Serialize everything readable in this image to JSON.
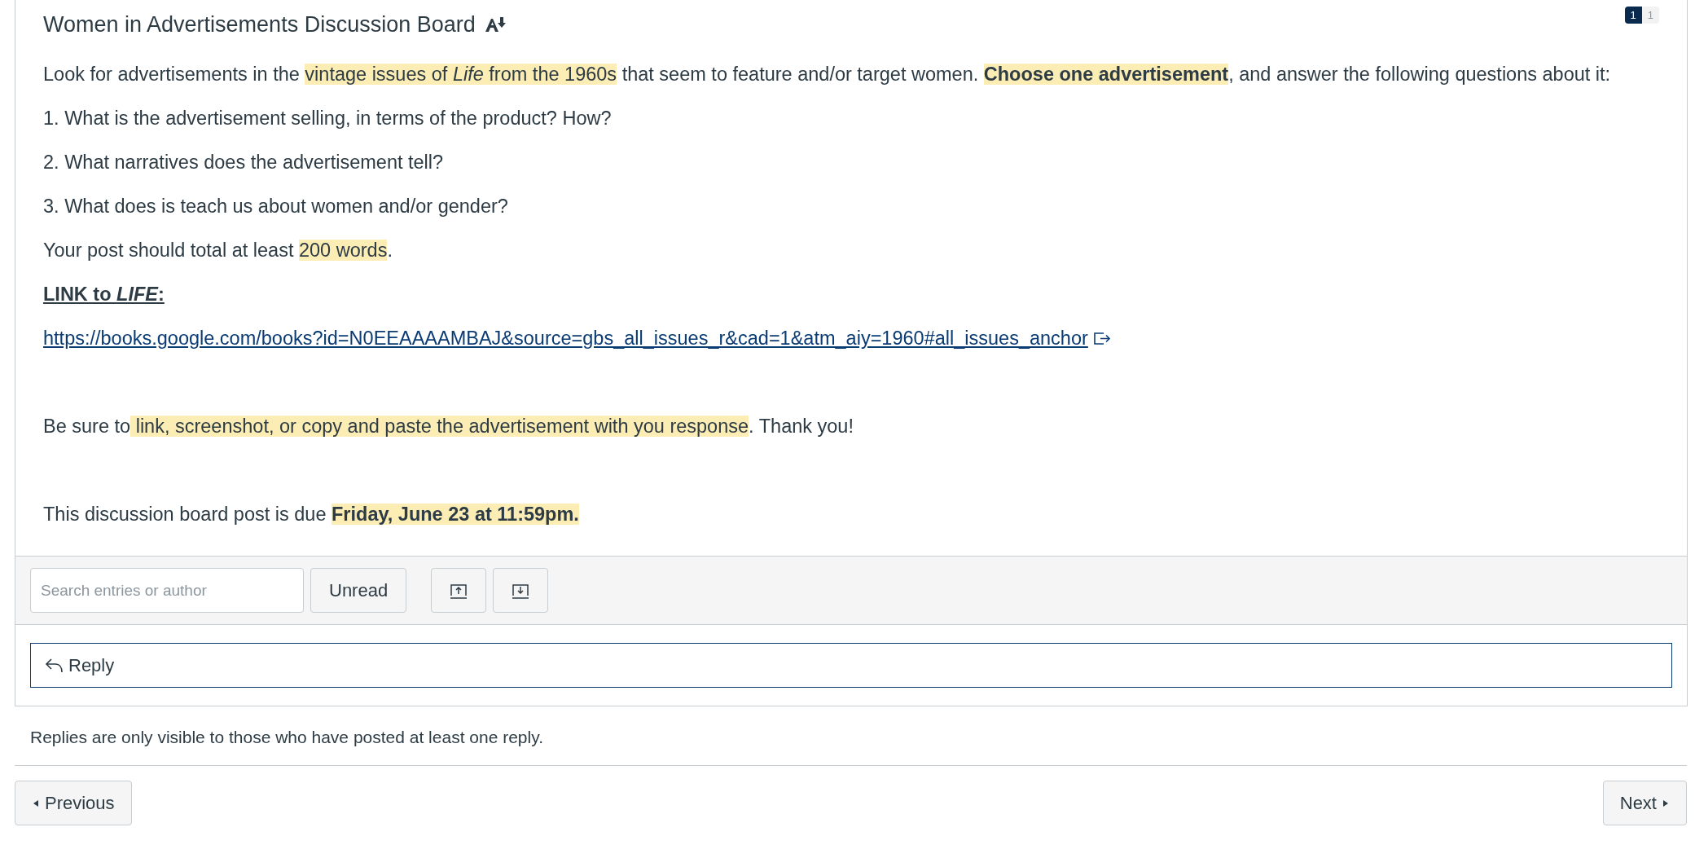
{
  "topic": {
    "title": "Women in Advertisements Discussion Board",
    "unread_count": "1",
    "total_count": "1"
  },
  "body": [
    {
      "kind": "text",
      "segments": [
        {
          "text": "Look for advertisements in the "
        },
        {
          "text": "vintage issues of ",
          "highlighted": true
        },
        {
          "text": "Life",
          "highlighted": true,
          "italic": true
        },
        {
          "text": " from the 1960s",
          "highlighted": true
        },
        {
          "text": " that seem to feature and/or target women. "
        },
        {
          "text": "Choose one advertisement",
          "highlighted": true,
          "bold": true
        },
        {
          "text": ", and answer the following questions about it:"
        }
      ]
    },
    {
      "kind": "text",
      "segments": [
        {
          "text": "1. What is the advertisement selling, in terms of the product? How?"
        }
      ]
    },
    {
      "kind": "text",
      "segments": [
        {
          "text": "2. What narratives does the advertisement tell?"
        }
      ]
    },
    {
      "kind": "text",
      "segments": [
        {
          "text": "3. What does is teach us about women and/or gender?"
        }
      ]
    },
    {
      "kind": "text",
      "segments": [
        {
          "text": "Your post should total at least "
        },
        {
          "text": "200 words",
          "highlighted": true
        },
        {
          "text": "."
        }
      ]
    },
    {
      "kind": "text",
      "underline": true,
      "segments": [
        {
          "text": "LINK to ",
          "bold": true
        },
        {
          "text": "LIFE",
          "bold": true,
          "italic": true
        },
        {
          "text": ":",
          "bold": true
        }
      ]
    },
    {
      "kind": "link",
      "segments": [
        {
          "text": "https://books.google.com/books?id=N0EEAAAAMBAJ&source=gbs_all_issues_r&cad=1&atm_aiy=1960#all_issues_anchor"
        }
      ]
    },
    {
      "kind": "spaced_text",
      "segments": [
        {
          "text": "Be sure to"
        },
        {
          "text": " link, screenshot, or copy and paste the advertisement with you response",
          "highlighted": true
        },
        {
          "text": ". Thank you!"
        }
      ]
    },
    {
      "kind": "spaced_text",
      "segments": [
        {
          "text": "This discussion board post is due "
        },
        {
          "text": "Friday, June 23 at 11:59pm. ",
          "highlighted": true,
          "bold": true
        }
      ]
    }
  ],
  "toolbar": {
    "search": {
      "placeholder": "Search entries or author"
    },
    "filter_button": "Unread"
  },
  "reply_button": "Reply",
  "notice": "Replies are only visible to those who have posted at least one reply.",
  "pager": {
    "previous": "Previous",
    "next": "Next"
  }
}
